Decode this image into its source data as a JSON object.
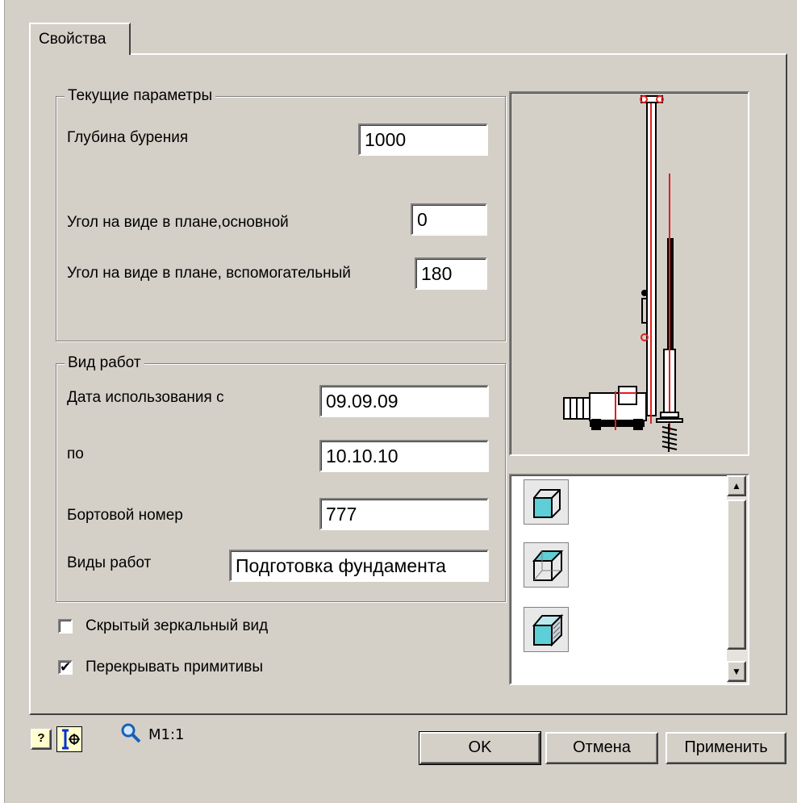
{
  "tab": {
    "label": "Свойства"
  },
  "group_current": {
    "legend": "Текущие параметры",
    "depth_label": "Глубина бурения",
    "depth_value": "1000",
    "angle_main_label": "Угол на виде в плане,основной",
    "angle_main_value": "0",
    "angle_aux_label": "Угол на виде в плане, вспомогательный",
    "angle_aux_value": "180"
  },
  "group_work": {
    "legend": "Вид работ",
    "date_from_label": "Дата использования с",
    "date_from_value": "09.09.09",
    "date_to_label": "по",
    "date_to_value": "10.10.10",
    "board_label": "Бортовой номер",
    "board_value": "777",
    "work_types_label": "Виды работ",
    "work_types_value": "Подготовка фундамента"
  },
  "checkboxes": {
    "hidden_mirror": {
      "label": "Скрытый зеркальный вид",
      "checked": false
    },
    "overlap": {
      "label": "Перекрывать примитивы",
      "checked": true
    }
  },
  "footer": {
    "scale": "M1:1",
    "ok": "OK",
    "cancel": "Отмена",
    "apply": "Применить"
  },
  "icons": [
    "help-icon",
    "insertion-point-icon",
    "zoom-icon",
    "cube-front-icon",
    "cube-top-icon",
    "cube-3d-icon",
    "scroll-up-icon",
    "scroll-down-icon",
    "drilling-rig-preview"
  ],
  "colors": {
    "background": "#d4d0c8",
    "field": "#ffffff",
    "cube_face": "#5ecfd6",
    "rig_axis": "#e02020"
  }
}
